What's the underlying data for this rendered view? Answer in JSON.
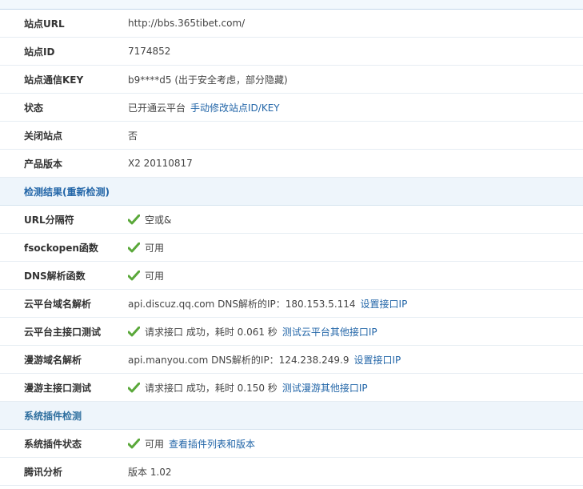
{
  "rows": {
    "site_url": {
      "label": "站点URL",
      "value": "http://bbs.365tibet.com/"
    },
    "site_id": {
      "label": "站点ID",
      "value": "7174852"
    },
    "site_key": {
      "label": "站点通信KEY",
      "value": "b9****d5 (出于安全考虑，部分隐藏)"
    },
    "status": {
      "label": "状态",
      "value": "已开通云平台",
      "link": "手动修改站点ID/KEY"
    },
    "close_site": {
      "label": "关闭站点",
      "value": "否"
    },
    "product_version": {
      "label": "产品版本",
      "value": "X2 20110817"
    }
  },
  "detect": {
    "title": "检测结果(重新检测)",
    "url_separator": {
      "label": "URL分隔符",
      "value": "空或&"
    },
    "fsockopen": {
      "label": "fsockopen函数",
      "value": "可用"
    },
    "dns": {
      "label": "DNS解析函数",
      "value": "可用"
    },
    "cloud_dns": {
      "label": "云平台域名解析",
      "value": "api.discuz.qq.com DNS解析的IP：180.153.5.114",
      "link": "设置接口IP"
    },
    "cloud_api": {
      "label": "云平台主接口测试",
      "value": "请求接口 成功，耗时 0.061 秒",
      "link": "测试云平台其他接口IP"
    },
    "manyou_dns": {
      "label": "漫游域名解析",
      "value": "api.manyou.com DNS解析的IP：124.238.249.9",
      "link": "设置接口IP"
    },
    "manyou_api": {
      "label": "漫游主接口测试",
      "value": "请求接口 成功，耗时 0.150 秒",
      "link": "测试漫游其他接口IP"
    }
  },
  "plugin": {
    "title": "系统插件检测",
    "status": {
      "label": "系统插件状态",
      "value": "可用",
      "link": "查看插件列表和版本"
    },
    "tencent": {
      "label": "腾讯分析",
      "value": "版本 1.02"
    }
  },
  "colors": {
    "check": "#5aa83a",
    "link": "#2366a8",
    "section": "#2f6f9f"
  },
  "icons": {
    "check": "check-icon"
  }
}
